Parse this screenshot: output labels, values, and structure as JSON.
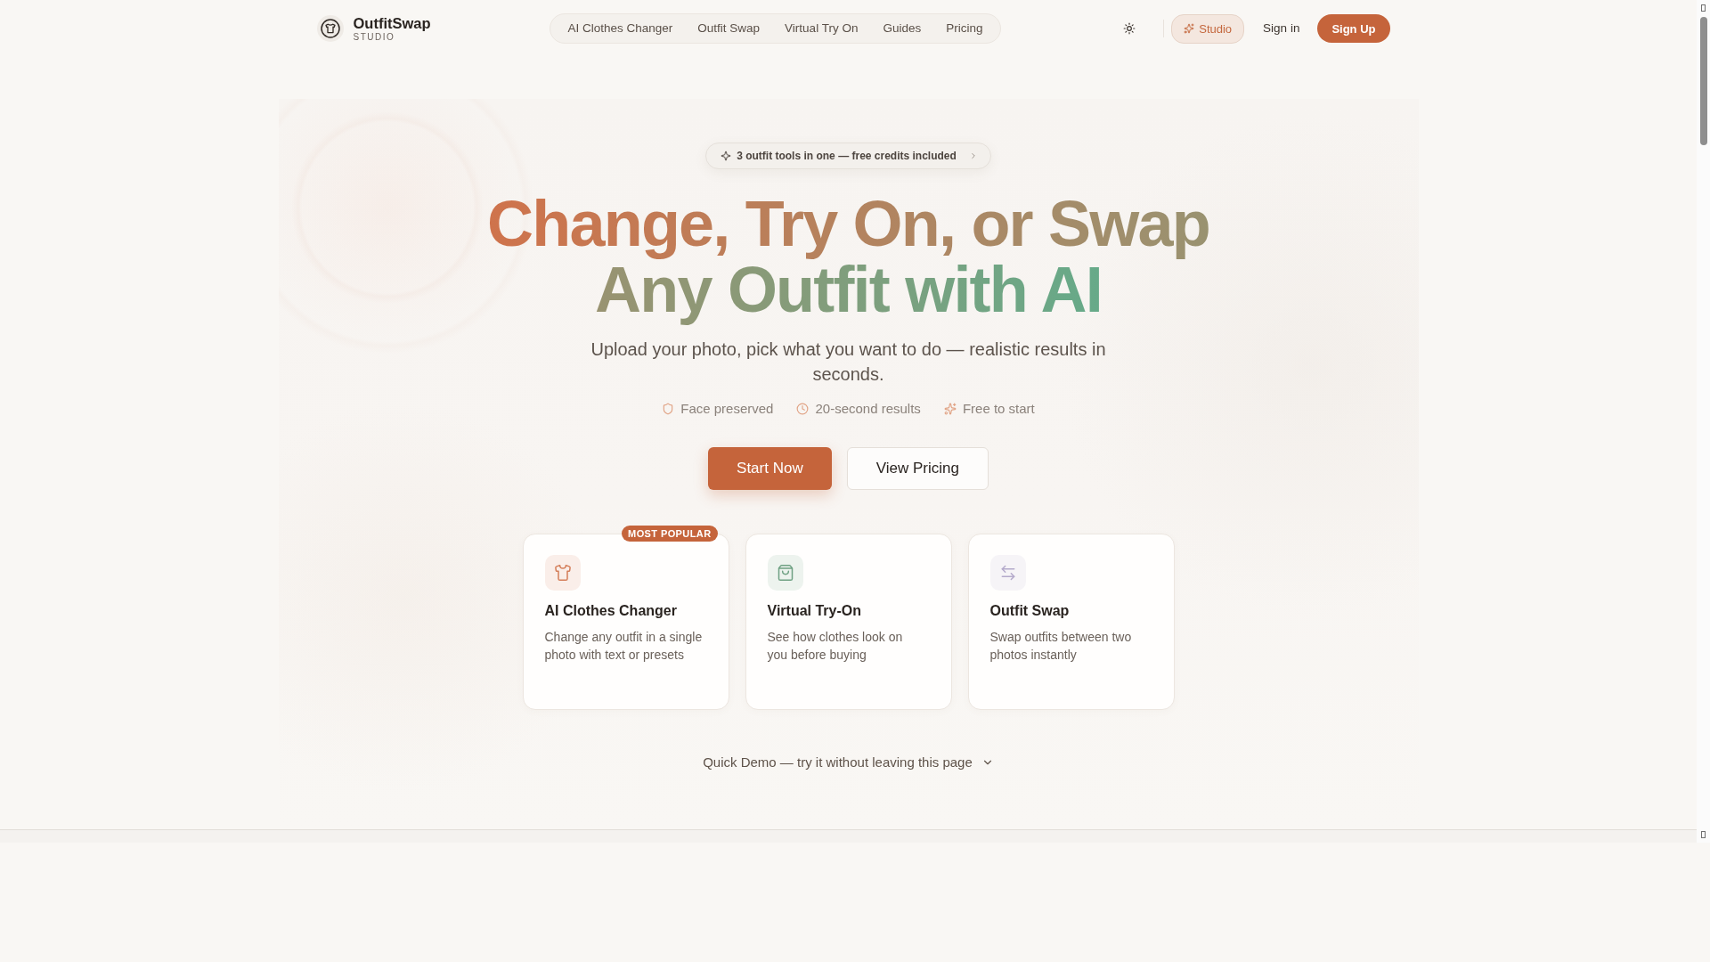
{
  "header": {
    "brand": {
      "name": "OutfitSwap",
      "tagline": "STUDIO"
    },
    "nav": [
      {
        "label": "AI Clothes Changer"
      },
      {
        "label": "Outfit Swap"
      },
      {
        "label": "Virtual Try On"
      },
      {
        "label": "Guides"
      },
      {
        "label": "Pricing"
      }
    ],
    "actions": [
      {
        "kind": "studio",
        "label": "Studio"
      },
      {
        "kind": "link",
        "label": "Sign in"
      },
      {
        "kind": "primary",
        "label": "Sign Up"
      }
    ]
  },
  "hero": {
    "announcement": "3 outfit tools in one — free credits included",
    "headline": [
      "Change, Try On, or Swap",
      "Any Outfit with AI"
    ],
    "subtitle": "Upload your photo, pick what you want to do — realistic results in seconds.",
    "highlights": [
      "Face preserved",
      "20-second results",
      "Free to start"
    ],
    "buttons": [
      {
        "kind": "primary",
        "label": "Start Now"
      },
      {
        "kind": "secondary",
        "label": "View Pricing"
      }
    ],
    "tools": [
      {
        "title": "AI Clothes Changer",
        "description": "Change any outfit in a single photo with text or presets",
        "badge": "MOST POPULAR",
        "color": "#d47d58"
      },
      {
        "title": "Virtual Try-On",
        "description": "See how clothes look on you before buying",
        "color": "#6fa183"
      },
      {
        "title": "Outfit Swap",
        "description": "Swap outfits between two photos instantly",
        "color": "#b4aacb"
      }
    ],
    "demo": {
      "label": "Quick Demo — try it without leaving this page",
      "expanded": false
    }
  }
}
